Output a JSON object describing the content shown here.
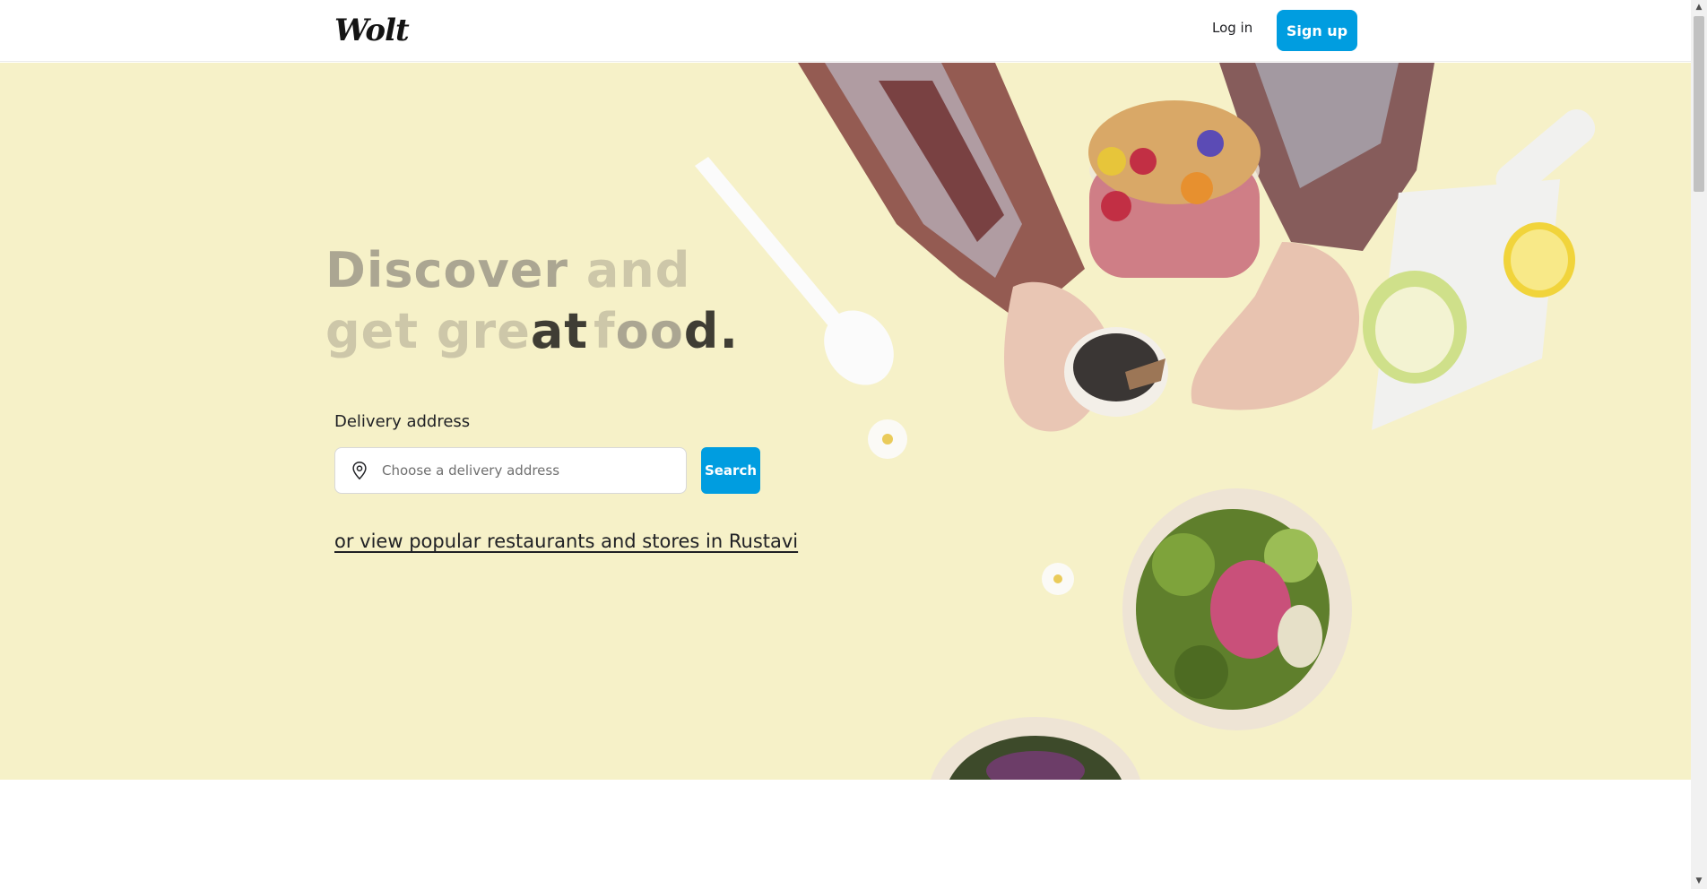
{
  "header": {
    "logo": "Wolt",
    "login_label": "Log in",
    "signup_label": "Sign up"
  },
  "hero": {
    "heading": {
      "line1": [
        {
          "text": "Discover",
          "tone": "mid"
        },
        {
          "text": "and",
          "tone": "dim"
        }
      ],
      "line2": [
        {
          "text": "get",
          "tone": "dim"
        },
        {
          "text": "gre",
          "tone": "dim"
        },
        {
          "text": "at",
          "tone": "dark"
        },
        {
          "text": "f",
          "tone": "dim"
        },
        {
          "text": "oo",
          "tone": "mid"
        },
        {
          "text": "d.",
          "tone": "dark"
        }
      ]
    },
    "delivery_label": "Delivery address",
    "address_placeholder": "Choose a delivery address",
    "search_label": "Search",
    "popular_link": "or view popular restaurants and stores in Rustavi",
    "background_color": "#f6f1c8"
  },
  "colors": {
    "accent": "#009de0",
    "text": "#202125"
  },
  "icons": {
    "address": "location-pin-icon"
  }
}
